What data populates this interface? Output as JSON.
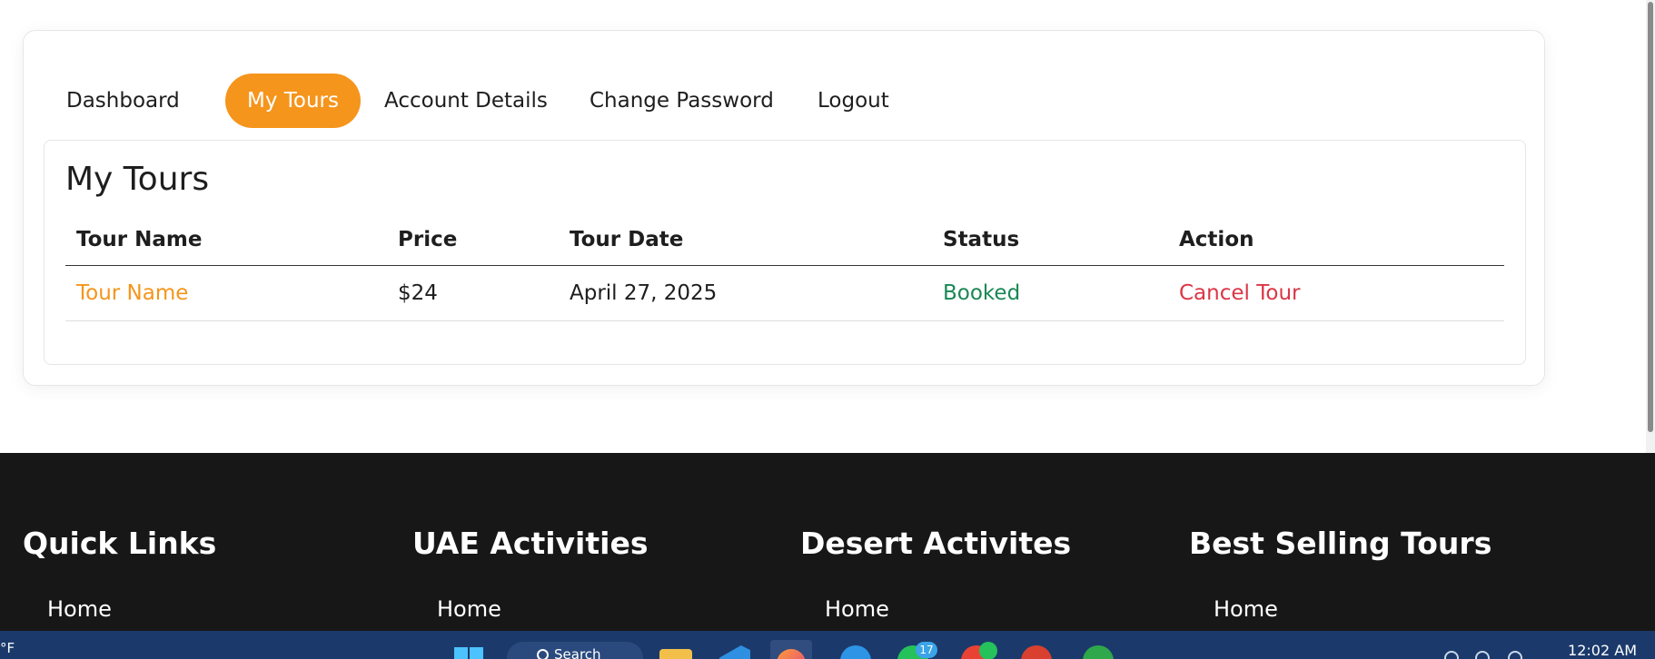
{
  "account_nav": {
    "tabs": [
      {
        "label": "Dashboard",
        "active": false
      },
      {
        "label": "My Tours",
        "active": true
      },
      {
        "label": "Account Details",
        "active": false
      },
      {
        "label": "Change Password",
        "active": false
      },
      {
        "label": "Logout",
        "active": false
      }
    ]
  },
  "tours": {
    "title": "My Tours",
    "columns": [
      "Tour Name",
      "Price",
      "Tour Date",
      "Status",
      "Action"
    ],
    "rows": [
      {
        "tour_name": "Tour Name",
        "price": "$24",
        "tour_date": "April 27, 2025",
        "status": "Booked",
        "action": "Cancel Tour"
      }
    ]
  },
  "footer": {
    "columns": [
      {
        "heading": "Quick Links",
        "links": [
          "Home"
        ]
      },
      {
        "heading": "UAE Activities",
        "links": [
          "Home"
        ]
      },
      {
        "heading": "Desert Activites",
        "links": [
          "Home"
        ]
      },
      {
        "heading": "Best Selling Tours",
        "links": [
          "Home"
        ]
      }
    ]
  },
  "taskbar": {
    "weather_unit": "°F",
    "search_label": "Search",
    "whatsapp_badge": "17",
    "clock": "12:02 AM"
  },
  "colors": {
    "accent": "#f5951c",
    "status_booked": "#198754",
    "cancel": "#dc3545",
    "footer_bg": "#171717",
    "taskbar_bg": "#1b3a6b"
  }
}
